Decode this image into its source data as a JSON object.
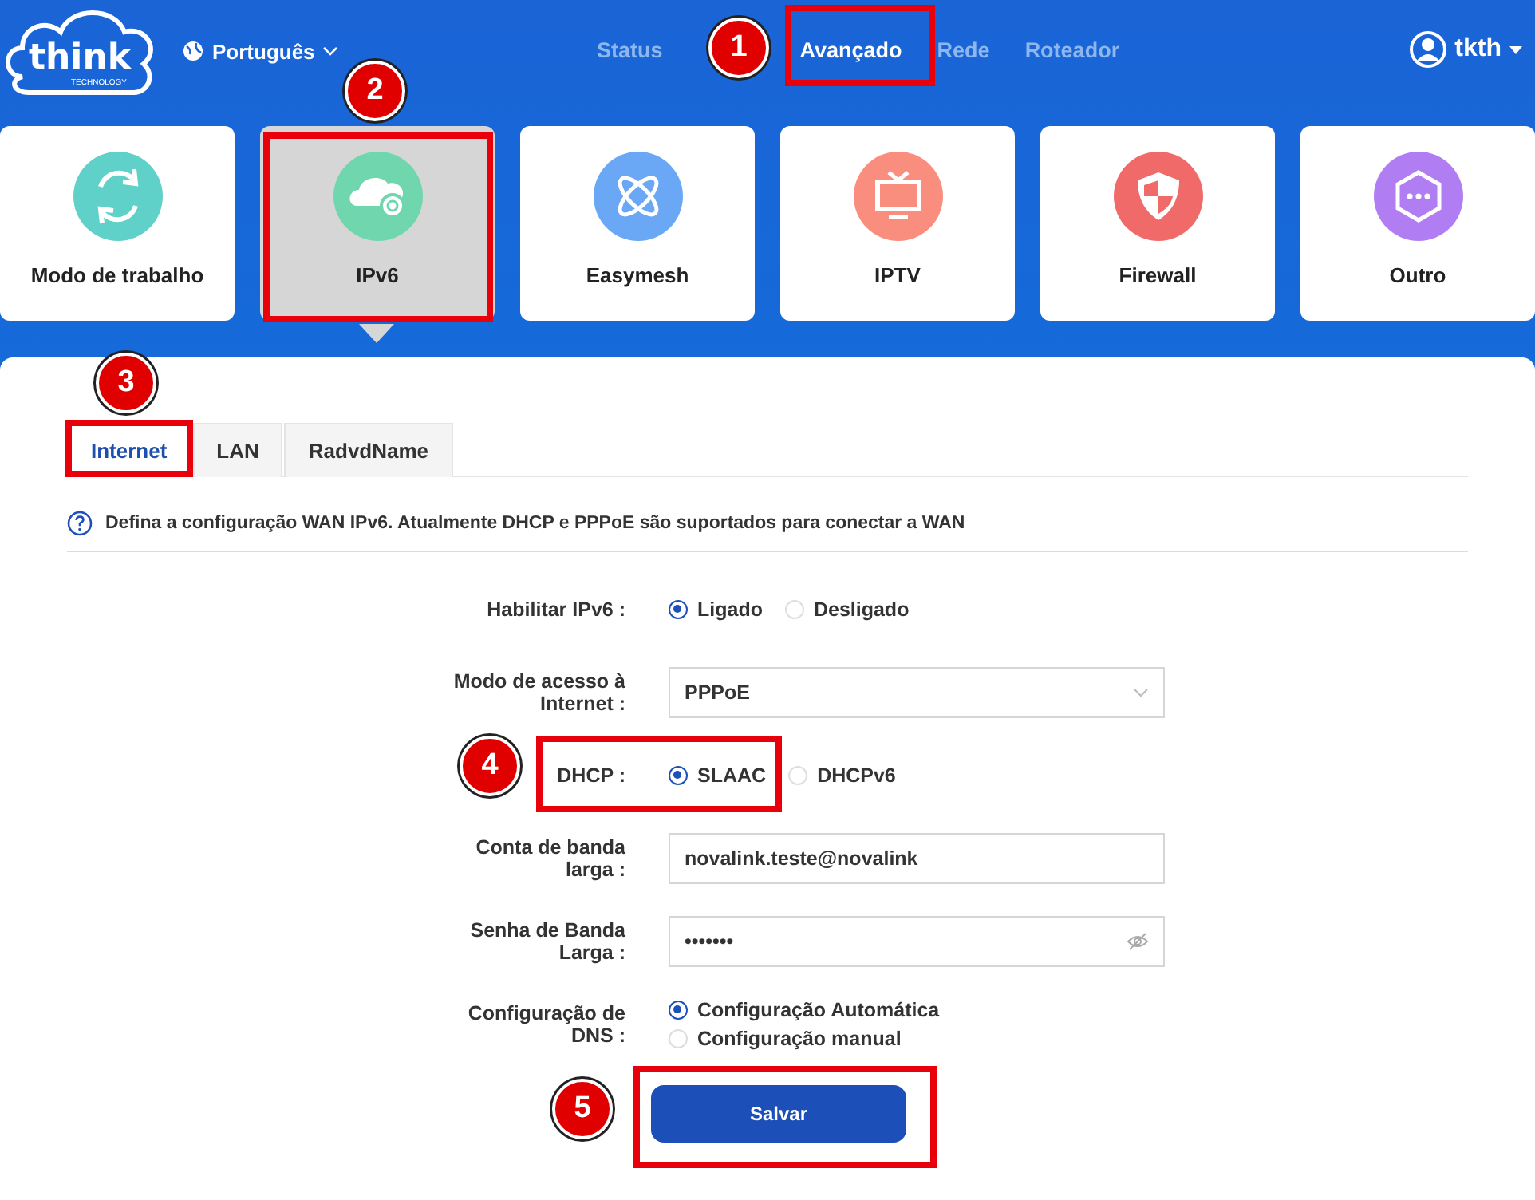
{
  "header": {
    "logo": {
      "name": "think",
      "tagline": "TECHNOLOGY"
    },
    "language": "Português",
    "nav": [
      {
        "label": "Status",
        "selected": false
      },
      {
        "label": "Avançado",
        "selected": true
      },
      {
        "label": "Rede",
        "selected": false
      },
      {
        "label": "Roteador",
        "selected": false
      }
    ],
    "user": "tkth"
  },
  "cards": [
    {
      "label": "Modo de trabalho",
      "selected": false,
      "color": "#5fd1c8"
    },
    {
      "label": "IPv6",
      "selected": true,
      "color": "#6fd6ad"
    },
    {
      "label": "Easymesh",
      "selected": false,
      "color": "#6aa8f5"
    },
    {
      "label": "IPTV",
      "selected": false,
      "color": "#f98d7e"
    },
    {
      "label": "Firewall",
      "selected": false,
      "color": "#f06a6a"
    },
    {
      "label": "Outro",
      "selected": false,
      "color": "#b17df2"
    }
  ],
  "tabs": [
    {
      "label": "Internet",
      "selected": true
    },
    {
      "label": "LAN",
      "selected": false
    },
    {
      "label": "RadvdName",
      "selected": false
    }
  ],
  "info": "Defina a configuração WAN IPv6. Atualmente DHCP e PPPoE são suportados para conectar a WAN",
  "form": [
    {
      "kind": "radio",
      "label": "Habilitar IPv6 :",
      "options": [
        {
          "label": "Ligado",
          "selected": true
        },
        {
          "label": "Desligado",
          "selected": false
        }
      ]
    },
    {
      "kind": "select",
      "label": "Modo de acesso à Internet :",
      "value": "PPPoE"
    },
    {
      "kind": "radio",
      "label": "DHCP :",
      "options": [
        {
          "label": "SLAAC",
          "selected": true
        },
        {
          "label": "DHCPv6",
          "selected": false
        }
      ]
    },
    {
      "kind": "text",
      "label": "Conta de banda larga :",
      "value": "novalink.teste@novalink"
    },
    {
      "kind": "password",
      "label": "Senha de Banda Larga :",
      "value": "•••••••"
    },
    {
      "kind": "radio-stack",
      "label": "Configuração de DNS :",
      "options": [
        {
          "label": "Configuração Automática",
          "selected": true
        },
        {
          "label": "Configuração manual",
          "selected": false
        }
      ]
    }
  ],
  "save_button": "Salvar",
  "annotations": [
    {
      "number": "1"
    },
    {
      "number": "2"
    },
    {
      "number": "3"
    },
    {
      "number": "4"
    },
    {
      "number": "5"
    }
  ]
}
